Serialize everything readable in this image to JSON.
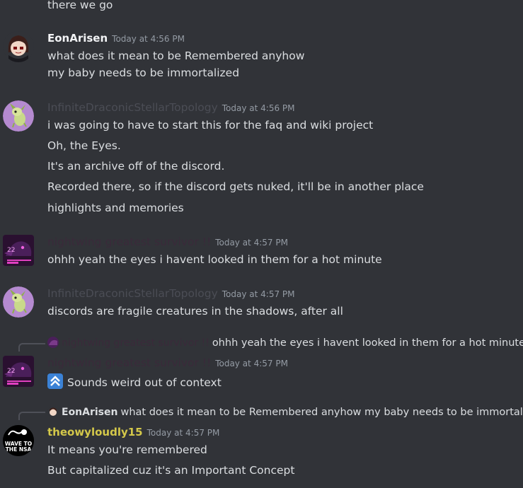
{
  "messages": [
    {
      "lines": [
        "there we go"
      ]
    },
    {
      "author": "EonArisen",
      "author_color": "#f2f3f5",
      "timestamp": "Today at 4:56 PM",
      "lines": [
        "what does it mean to be Remembered anyhow",
        "my baby needs to be immortalized"
      ]
    },
    {
      "author": "InfiniteDraconicStellarTopology",
      "author_color": "#4b4d55",
      "timestamp": "Today at 4:56 PM",
      "lines": [
        "i was going to have to start this for the faq and wiki project",
        "Oh, the Eyes.",
        "It's an archive off of the discord.",
        "Recorded there, so if the discord gets nuked, it'll be in another place",
        "highlights and memories"
      ]
    },
    {
      "author": "nightwing greatest survivor !!",
      "author_color": "#3a2a3a",
      "timestamp": "Today at 4:57 PM",
      "lines": [
        "ohhh yeah the eyes i havent looked in them for a hot minute"
      ]
    },
    {
      "author": "InfiniteDraconicStellarTopology",
      "author_color": "#4b4d55",
      "timestamp": "Today at 4:57 PM",
      "lines": [
        "discords are fragile creatures in the shadows, after all"
      ]
    },
    {
      "reply": {
        "author": "nightwing greatest survivor !!",
        "text": "ohhh yeah the eyes i havent looked in them for a hot minute"
      },
      "author": "nightwing greatest survivor !!",
      "author_color": "#3a2a3a",
      "timestamp": "Today at 4:57 PM",
      "emoji": "up-arrow-emoji",
      "lines": [
        "Sounds weird out of context"
      ]
    },
    {
      "reply": {
        "author": "EonArisen",
        "text": "what does it mean to be Remembered anyhow my baby needs to be immortalized"
      },
      "author": "theowyloudly15",
      "author_color": "#d4c84a",
      "timestamp": "Today at 4:57 PM",
      "avatar_text": [
        "WAVE TO",
        "THE NSA"
      ],
      "lines": [
        "It means you're remembered",
        "But capitalized cuz it's an Important Concept"
      ]
    }
  ]
}
